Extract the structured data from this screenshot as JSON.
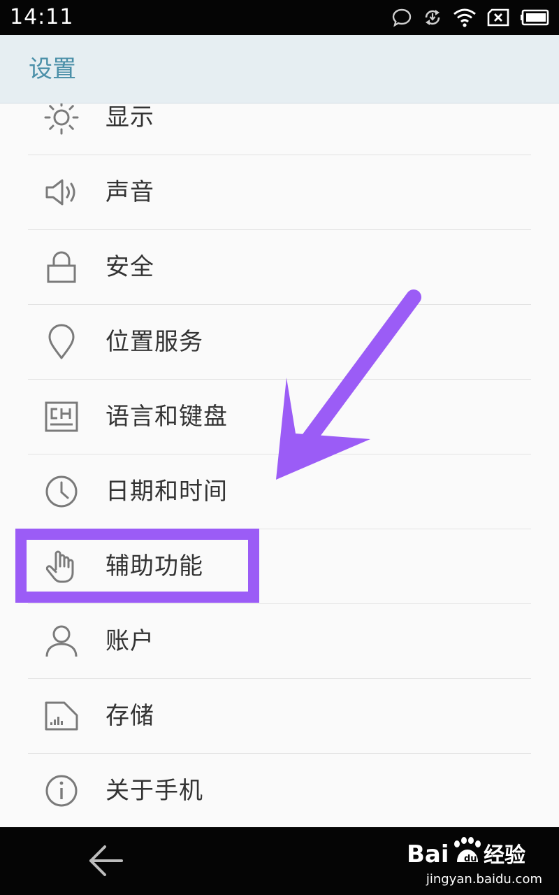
{
  "status_bar": {
    "time": "14:11"
  },
  "header": {
    "title": "设置"
  },
  "settings": {
    "items": [
      {
        "label": "显示",
        "icon": "brightness-icon"
      },
      {
        "label": "声音",
        "icon": "speaker-icon"
      },
      {
        "label": "安全",
        "icon": "lock-icon"
      },
      {
        "label": "位置服务",
        "icon": "location-pin-icon"
      },
      {
        "label": "语言和键盘",
        "icon": "language-keyboard-icon"
      },
      {
        "label": "日期和时间",
        "icon": "clock-icon"
      },
      {
        "label": "辅助功能",
        "icon": "hand-pointer-icon"
      },
      {
        "label": "账户",
        "icon": "person-icon"
      },
      {
        "label": "存储",
        "icon": "sd-card-icon"
      },
      {
        "label": "关于手机",
        "icon": "info-icon"
      }
    ]
  },
  "watermark": {
    "url": "jingyan.baidu.com"
  },
  "colors": {
    "status_bar": "#050505",
    "header_bg": "#e6eef2",
    "header_title": "#4a8fa8",
    "list_bg": "#fafafa",
    "item_text": "#333333",
    "icon": "#7a7a7a",
    "annotation": "#9b5cf6"
  }
}
